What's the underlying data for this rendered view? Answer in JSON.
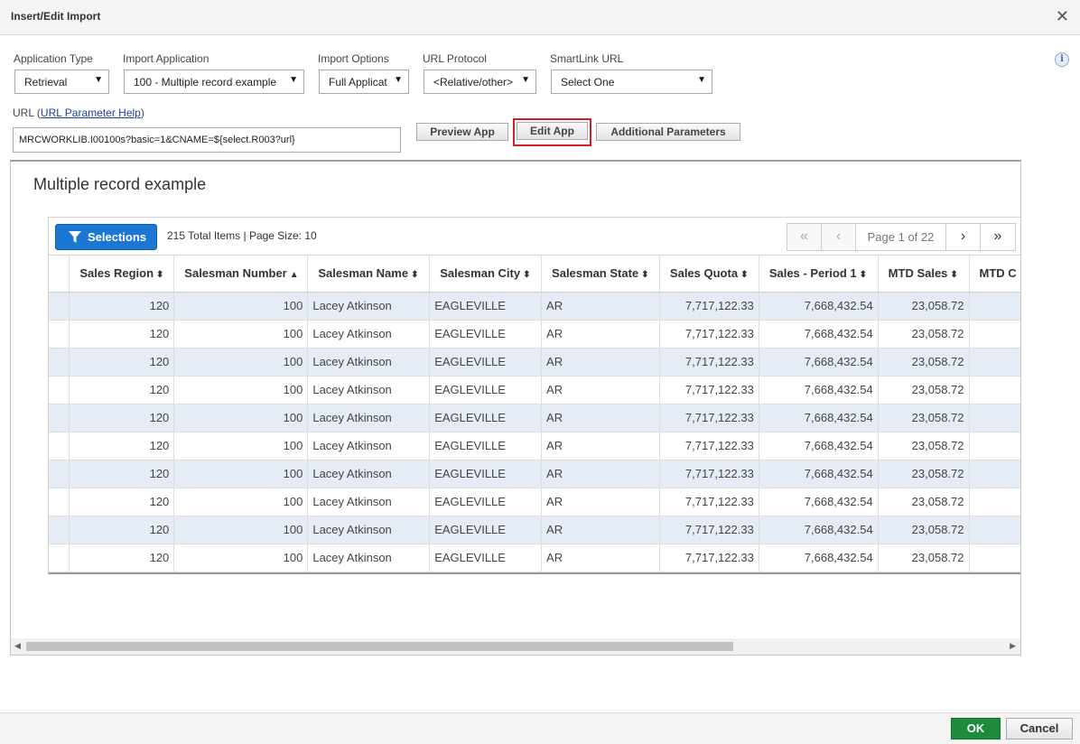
{
  "dialog": {
    "title": "Insert/Edit Import",
    "close_glyph": "✕"
  },
  "info_icon": "i",
  "fields": {
    "app_type": {
      "label": "Application Type",
      "value": "Retrieval"
    },
    "import_app": {
      "label": "Import Application",
      "value": "100 - Multiple record example"
    },
    "import_options": {
      "label": "Import Options",
      "value": "Full Applicat"
    },
    "url_protocol": {
      "label": "URL Protocol",
      "value": "<Relative/other>"
    },
    "smartlink": {
      "label": "SmartLink URL",
      "value": "Select One"
    }
  },
  "url": {
    "label": "URL",
    "help_link": "URL Parameter Help",
    "value": "MRCWORKLIB.I00100s?basic=1&CNAME=${select.R003?url}"
  },
  "buttons": {
    "preview": "Preview App",
    "edit": "Edit App",
    "additional": "Additional Parameters",
    "ok": "OK",
    "cancel": "Cancel"
  },
  "preview": {
    "app_title": "Multiple record example",
    "selections_label": "Selections",
    "totals": "215 Total Items | Page Size: 10",
    "page_info": "Page 1 of 22",
    "pager": {
      "first": "«",
      "prev": "‹",
      "next": "›",
      "last": "»"
    },
    "sort_glyph": "⬍",
    "sort_asc_glyph": "▲",
    "columns": [
      "Sales Region",
      "Salesman Number",
      "Salesman Name",
      "Salesman City",
      "Salesman State",
      "Sales Quota",
      "Sales - Period 1",
      "MTD Sales",
      "MTD C"
    ],
    "rows": [
      [
        "120",
        "100",
        "Lacey Atkinson",
        "EAGLEVILLE",
        "AR",
        "7,717,122.33",
        "7,668,432.54",
        "23,058.72",
        ""
      ],
      [
        "120",
        "100",
        "Lacey Atkinson",
        "EAGLEVILLE",
        "AR",
        "7,717,122.33",
        "7,668,432.54",
        "23,058.72",
        ""
      ],
      [
        "120",
        "100",
        "Lacey Atkinson",
        "EAGLEVILLE",
        "AR",
        "7,717,122.33",
        "7,668,432.54",
        "23,058.72",
        ""
      ],
      [
        "120",
        "100",
        "Lacey Atkinson",
        "EAGLEVILLE",
        "AR",
        "7,717,122.33",
        "7,668,432.54",
        "23,058.72",
        ""
      ],
      [
        "120",
        "100",
        "Lacey Atkinson",
        "EAGLEVILLE",
        "AR",
        "7,717,122.33",
        "7,668,432.54",
        "23,058.72",
        ""
      ],
      [
        "120",
        "100",
        "Lacey Atkinson",
        "EAGLEVILLE",
        "AR",
        "7,717,122.33",
        "7,668,432.54",
        "23,058.72",
        ""
      ],
      [
        "120",
        "100",
        "Lacey Atkinson",
        "EAGLEVILLE",
        "AR",
        "7,717,122.33",
        "7,668,432.54",
        "23,058.72",
        ""
      ],
      [
        "120",
        "100",
        "Lacey Atkinson",
        "EAGLEVILLE",
        "AR",
        "7,717,122.33",
        "7,668,432.54",
        "23,058.72",
        ""
      ],
      [
        "120",
        "100",
        "Lacey Atkinson",
        "EAGLEVILLE",
        "AR",
        "7,717,122.33",
        "7,668,432.54",
        "23,058.72",
        ""
      ],
      [
        "120",
        "100",
        "Lacey Atkinson",
        "EAGLEVILLE",
        "AR",
        "7,717,122.33",
        "7,668,432.54",
        "23,058.72",
        ""
      ]
    ]
  },
  "colors": {
    "accent": "#1c77d3",
    "ok": "#1d8a3c",
    "highlight": "#d0202c",
    "row_alt": "#e6ecf6"
  }
}
